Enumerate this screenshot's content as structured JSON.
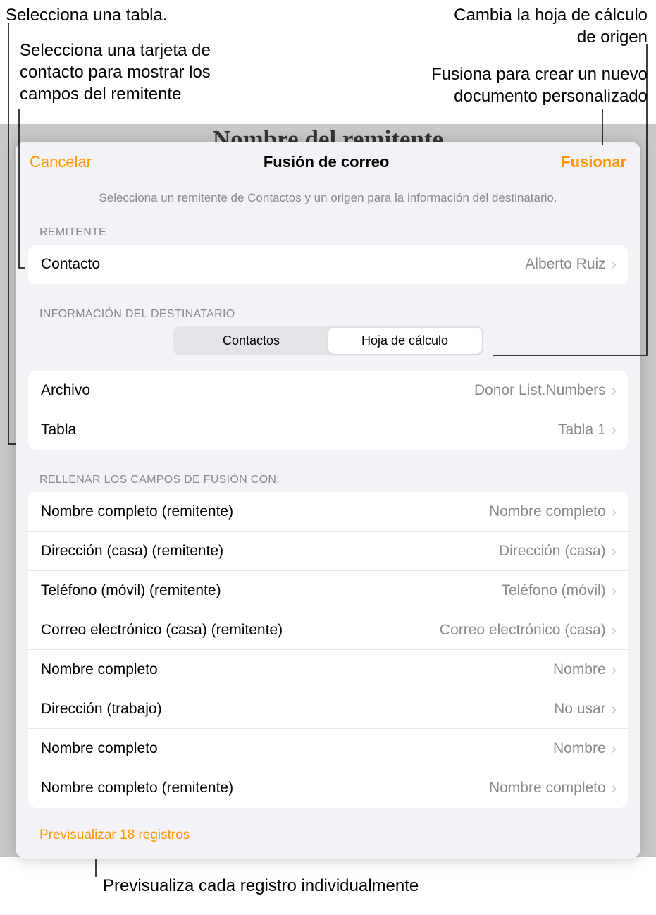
{
  "annotations": {
    "table": "Selecciona una tabla.",
    "contact_card": "Selecciona una tarjeta de contacto para mostrar los campos del remitente",
    "change_source": "Cambia la hoja de cálculo de origen",
    "merge_new": "Fusiona para crear un nuevo documento personalizado",
    "preview_each": "Previsualiza cada registro individualmente"
  },
  "background_title": "Nombre del remitente",
  "modal": {
    "cancel": "Cancelar",
    "title": "Fusión de correo",
    "merge": "Fusionar",
    "subtitle": "Selecciona un remitente de Contactos y un origen para la información del destinatario."
  },
  "sender": {
    "header": "REMITENTE",
    "contact_label": "Contacto",
    "contact_value": "Alberto Ruiz"
  },
  "recipient": {
    "header": "INFORMACIÓN DEL DESTINATARIO",
    "segment_contacts": "Contactos",
    "segment_spreadsheet": "Hoja de cálculo"
  },
  "source": {
    "file_label": "Archivo",
    "file_value": "Donor List.Numbers",
    "table_label": "Tabla",
    "table_value": "Tabla 1"
  },
  "fields": {
    "header": "RELLENAR LOS CAMPOS DE FUSIÓN CON:",
    "rows": [
      {
        "label": "Nombre completo (remitente)",
        "value": "Nombre completo"
      },
      {
        "label": "Dirección (casa) (remitente)",
        "value": "Dirección (casa)"
      },
      {
        "label": "Teléfono (móvil) (remitente)",
        "value": "Teléfono (móvil)"
      },
      {
        "label": "Correo electrónico (casa) (remitente)",
        "value": "Correo electrónico (casa)"
      },
      {
        "label": "Nombre completo",
        "value": "Nombre"
      },
      {
        "label": "Dirección (trabajo)",
        "value": "No usar"
      },
      {
        "label": "Nombre completo",
        "value": "Nombre"
      },
      {
        "label": "Nombre completo (remitente)",
        "value": "Nombre completo"
      }
    ]
  },
  "preview_link": "Previsualizar 18 registros"
}
